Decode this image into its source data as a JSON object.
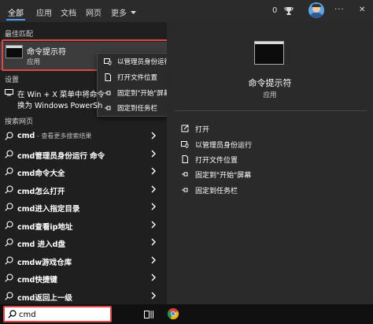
{
  "tabs": [
    {
      "label": "全部",
      "active": true
    },
    {
      "label": "应用",
      "active": false
    },
    {
      "label": "文档",
      "active": false
    },
    {
      "label": "网页",
      "active": false
    },
    {
      "label": "更多",
      "active": false
    }
  ],
  "top_right": {
    "points": "0",
    "ellipsis": "···",
    "close": "✕"
  },
  "best_match": {
    "section_title": "最佳匹配",
    "app_name": "命令提示符",
    "app_type": "应用"
  },
  "context_menu": {
    "items": [
      {
        "label": "以管理员身份运行",
        "icon": "admin-shield-icon"
      },
      {
        "label": "打开文件位置",
        "icon": "file-icon"
      },
      {
        "label": "固定到\"开始\"屏幕",
        "icon": "pin-icon"
      },
      {
        "label": "固定到任务栏",
        "icon": "pin-icon"
      }
    ]
  },
  "settings": {
    "section_title": "设置",
    "item_line1": "在 Win + X 菜单中将命令",
    "item_line2": "换为 Windows PowerSh"
  },
  "web_search": {
    "section_title": "搜索网页",
    "items": [
      {
        "main": "cmd",
        "sub": " - 查看更多搜索结果"
      },
      {
        "main": "cmd管理员身份运行 命令",
        "sub": ""
      },
      {
        "main": "cmd命令大全",
        "sub": ""
      },
      {
        "main": "cmd怎么打开",
        "sub": ""
      },
      {
        "main": "cmd进入指定目录",
        "sub": ""
      },
      {
        "main": "cmd查看ip地址",
        "sub": ""
      },
      {
        "main": "cmd 进入d盘",
        "sub": ""
      },
      {
        "main": "cmdw游戏仓库",
        "sub": ""
      },
      {
        "main": "cmd快捷键",
        "sub": ""
      },
      {
        "main": "cmd返回上一级",
        "sub": ""
      }
    ]
  },
  "preview": {
    "app_name": "命令提示符",
    "app_type": "应用",
    "actions": [
      {
        "label": "打开",
        "icon": "open-icon"
      },
      {
        "label": "以管理员身份运行",
        "icon": "admin-shield-icon"
      },
      {
        "label": "打开文件位置",
        "icon": "file-icon"
      },
      {
        "label": "固定到\"开始\"屏幕",
        "icon": "pin-icon"
      },
      {
        "label": "固定到任务栏",
        "icon": "pin-icon"
      }
    ]
  },
  "search": {
    "value": "cmd"
  },
  "colors": {
    "accent": "#4c9bf0",
    "highlight_outline": "#e04646",
    "pane_dark": "#1f1f1f",
    "pane_right": "#2a2a2a"
  }
}
